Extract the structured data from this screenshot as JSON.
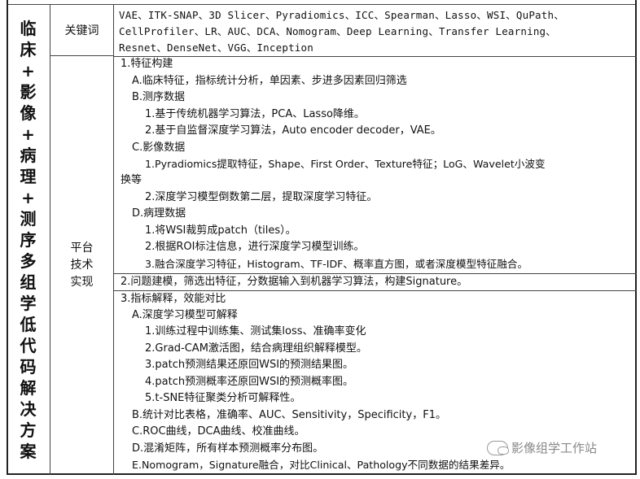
{
  "left_title": [
    "临",
    "床",
    "+",
    "影",
    "像",
    "+",
    "病",
    "理",
    "+",
    "测",
    "序",
    "多",
    "组",
    "学",
    "低",
    "代",
    "码",
    "解",
    "决",
    "方",
    "案"
  ],
  "keywords_label": "关键词",
  "keywords_lines": [
    "VAE、ITK-SNAP、3D Slicer、Pyradiomics、ICC、Spearman、Lasso、WSI、QuPath、",
    "CellProfiler、LR、AUC、DCA、Nomogram、Deep Learning、Transfer Learning、",
    "Resnet、DenseNet、VGG、Inception"
  ],
  "platform_label": [
    "平台",
    "技术",
    "实现"
  ],
  "lines": {
    "l1": "1.特征构建",
    "l2": "A.临床特征，指标统计分析，单因素、步进多因素回归筛选",
    "l3": "B.测序数据",
    "l4": "1.基于传统机器学习算法，PCA、Lasso降维。",
    "l5": "2.基于自监督深度学习算法，Auto encoder decoder，VAE。",
    "l6": "C.影像数据",
    "l7": "1.Pyradiomics提取特征，Shape、First Order、Texture特征；LoG、Wavelet小波变",
    "l8": "换等",
    "l9": "2.深度学习模型倒数第二层，提取深度学习特征。",
    "l10": "D.病理数据",
    "l11": "1.将WSI裁剪成patch（tiles）。",
    "l12": "2.根据ROI标注信息，进行深度学习模型训练。",
    "l13": "3.融合深度学习特征，Histogram、TF-IDF、概率直方图，或者深度模型特征融合。",
    "l14": "2.问题建模，筛选出特征，分数据输入到机器学习算法，构建Signature。",
    "l15": "3.指标解释，效能对比",
    "l16": "A.深度学习模型可解释",
    "l17": "1.训练过程中训练集、测试集loss、准确率变化",
    "l18": "2.Grad-CAM激活图，结合病理组织解释模型。",
    "l19": "3.patch预测结果还原回WSI的预测结果图。",
    "l20": "4.patch预测概率还原回WSI的预测概率图。",
    "l21": "5.t-SNE特征聚类分析可解释性。",
    "l22": "B.统计对比表格，准确率、AUC、Sensitivity，Specificity，F1。",
    "l23": "C.ROC曲线，DCA曲线、校准曲线。",
    "l24": "D.混淆矩阵，所有样本预测概率分布图。",
    "l25": "E.Nomogram，Signature融合，对比Clinical、Pathology不同数据的结果差异。"
  },
  "watermark": "影像组学工作站",
  "watermark_icon": "wechat-icon"
}
